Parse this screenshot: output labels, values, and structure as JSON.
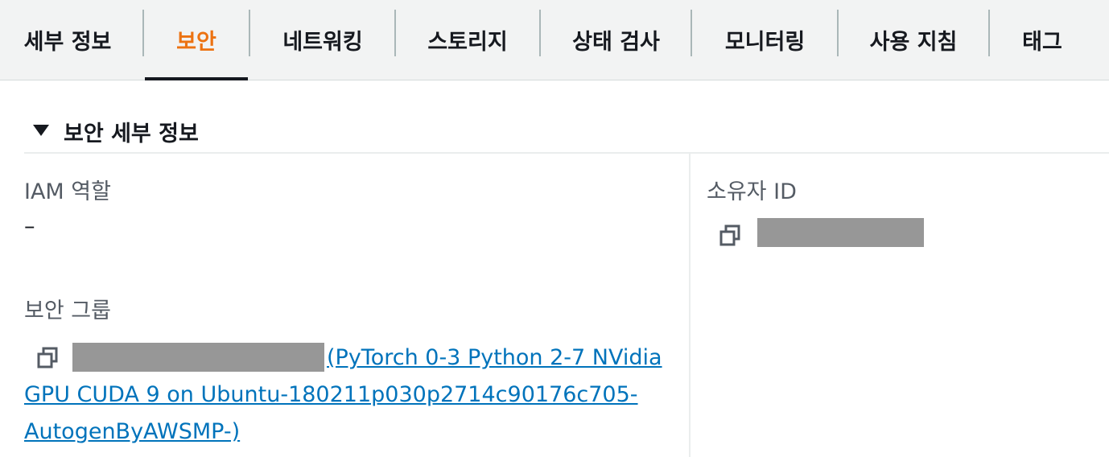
{
  "tabs": [
    {
      "label": "세부 정보",
      "active": false
    },
    {
      "label": "보안",
      "active": true
    },
    {
      "label": "네트워킹",
      "active": false
    },
    {
      "label": "스토리지",
      "active": false
    },
    {
      "label": "상태 검사",
      "active": false
    },
    {
      "label": "모니터링",
      "active": false
    },
    {
      "label": "사용 지침",
      "active": false
    },
    {
      "label": "태그",
      "active": false
    }
  ],
  "section": {
    "title": "보안 세부 정보"
  },
  "left": {
    "iam_role_label": "IAM 역할",
    "iam_role_value": "–",
    "security_group_label": "보안 그룹",
    "security_group_name": "(PyTorch 0-3 Python 2-7 NVidia GPU CUDA 9 on Ubuntu-180211p030p2714c90176c705-AutogenByAWSMP-)"
  },
  "right": {
    "owner_id_label": "소유자 ID"
  },
  "icons": {
    "caret": "caret-down-icon",
    "copy": "copy-icon"
  },
  "colors": {
    "active_tab": "#ec7211",
    "link": "#0073bb",
    "redacted": "#979797"
  }
}
